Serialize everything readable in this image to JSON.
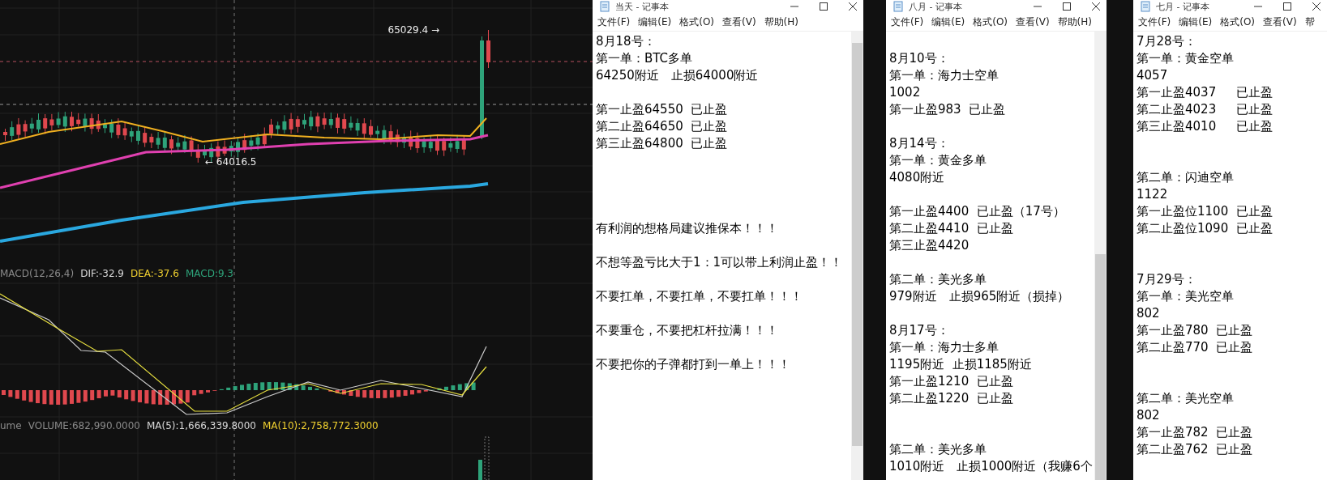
{
  "chart": {
    "high_label": "65029.4 →",
    "low_label": "← 64016.5",
    "macd_legend": [
      {
        "text": "MACD(12,26,4)",
        "color": "#8a8a8a"
      },
      {
        "text": "DIF:-32.9",
        "color": "#d8d8d8"
      },
      {
        "text": "DEA:-37.6",
        "color": "#f0d030"
      },
      {
        "text": "MACD:9.3",
        "color": "#2ea37a"
      }
    ],
    "volume_legend": [
      {
        "text": "ume",
        "color": "#8a8a8a"
      },
      {
        "text": "VOLUME:682,990.0000",
        "color": "#8a8a8a"
      },
      {
        "text": "MA(5):1,666,339.8000",
        "color": "#d8d8d8"
      },
      {
        "text": "MA(10):2,758,772.3000",
        "color": "#f0d030"
      }
    ]
  },
  "notepads": [
    {
      "title": "当天 - 记事本",
      "menu": [
        "文件(F)",
        "编辑(E)",
        "格式(O)",
        "查看(V)",
        "帮助(H)"
      ],
      "has_scrollbar": true,
      "blocks": [
        {
          "kind": "text",
          "lines": [
            "8月18号：",
            "第一单：BTC多单",
            "64250附近　止损64000附近"
          ]
        },
        {
          "kind": "blank"
        },
        {
          "kind": "text",
          "lines": [
            "第一止盈64550  已止盈",
            "第二止盈64650  已止盈",
            "第三止盈64800  已止盈"
          ]
        },
        {
          "kind": "blank"
        },
        {
          "kind": "blank"
        },
        {
          "kind": "blank"
        },
        {
          "kind": "blank"
        },
        {
          "kind": "text",
          "lines": [
            "有利润的想格局建议推保本！！！"
          ]
        },
        {
          "kind": "blank"
        },
        {
          "kind": "text",
          "lines": [
            "不想等盈亏比大于1：1可以带上利润止盈！！"
          ]
        },
        {
          "kind": "blank"
        },
        {
          "kind": "text",
          "lines": [
            "不要扛单，不要扛单，不要扛单！！！"
          ]
        },
        {
          "kind": "blank"
        },
        {
          "kind": "text",
          "lines": [
            "不要重仓，不要把杠杆拉满！！！"
          ]
        },
        {
          "kind": "blank"
        },
        {
          "kind": "text",
          "lines": [
            "不要把你的子弹都打到一单上！！！"
          ]
        }
      ]
    },
    {
      "title": "八月 - 记事本",
      "menu": [
        "文件(F)",
        "编辑(E)",
        "格式(O)",
        "查看(V)",
        "帮助(H)"
      ],
      "has_scrollbar": true,
      "blocks": [
        {
          "kind": "blank"
        },
        {
          "kind": "text",
          "lines": [
            "8月10号：",
            "第一单：海力士空单",
            "1002",
            "第一止盈983  已止盈"
          ]
        },
        {
          "kind": "blank"
        },
        {
          "kind": "text",
          "lines": [
            "8月14号：",
            "第一单：黄金多单",
            "4080附近"
          ]
        },
        {
          "kind": "blank"
        },
        {
          "kind": "text",
          "lines": [
            "第一止盈4400  已止盈（17号）",
            "第二止盈4410  已止盈",
            "第三止盈4420"
          ]
        },
        {
          "kind": "blank"
        },
        {
          "kind": "text",
          "lines": [
            "第二单：美光多单",
            "979附近　止损965附近（损掉）"
          ]
        },
        {
          "kind": "blank"
        },
        {
          "kind": "text",
          "lines": [
            "8月17号：",
            "第一单：海力士多单",
            "1195附近  止损1185附近",
            "第一止盈1210  已止盈",
            "第二止盈1220  已止盈"
          ]
        },
        {
          "kind": "blank"
        },
        {
          "kind": "blank"
        },
        {
          "kind": "text",
          "lines": [
            "第二单：美光多单",
            "1010附近　止损1000附近（我赚6个"
          ]
        }
      ]
    },
    {
      "title": "七月 - 记事本",
      "menu": [
        "文件(F)",
        "编辑(E)",
        "格式(O)",
        "查看(V)",
        "帮"
      ],
      "has_scrollbar": false,
      "blocks": [
        {
          "kind": "text",
          "lines": [
            "7月28号：",
            "第一单：黄金空单",
            "4057",
            "第一止盈4037　  已止盈",
            "第二止盈4023　  已止盈",
            "第三止盈4010　  已止盈"
          ]
        },
        {
          "kind": "blank"
        },
        {
          "kind": "blank"
        },
        {
          "kind": "text",
          "lines": [
            "第二单：闪迪空单",
            "1122",
            "第一止盈位1100  已止盈",
            "第二止盈位1090  已止盈"
          ]
        },
        {
          "kind": "blank"
        },
        {
          "kind": "blank"
        },
        {
          "kind": "text",
          "lines": [
            "7月29号：",
            "第一单：美光空单",
            "802",
            "第一止盈780  已止盈",
            "第二止盈770  已止盈"
          ]
        },
        {
          "kind": "blank"
        },
        {
          "kind": "blank"
        },
        {
          "kind": "text",
          "lines": [
            "第二单：美光空单",
            "802",
            "第一止盈782  已止盈",
            "第二止盈762  已止盈"
          ]
        }
      ]
    }
  ]
}
